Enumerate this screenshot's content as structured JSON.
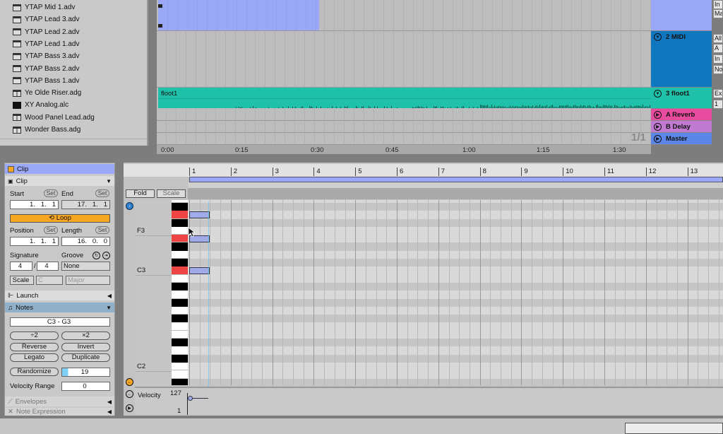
{
  "browser": {
    "items": [
      {
        "label": "YTAP Mid 1.adv",
        "icon": "preset-icon"
      },
      {
        "label": "YTAP Lead 3.adv",
        "icon": "preset-icon"
      },
      {
        "label": "YTAP Lead 2.adv",
        "icon": "preset-icon"
      },
      {
        "label": "YTAP Lead 1.adv",
        "icon": "preset-icon"
      },
      {
        "label": "YTAP Bass 3.adv",
        "icon": "preset-icon"
      },
      {
        "label": "YTAP Bass 2.adv",
        "icon": "preset-icon"
      },
      {
        "label": "YTAP Bass 1.adv",
        "icon": "preset-icon"
      },
      {
        "label": "Ye Olde Riser.adg",
        "icon": "rack-icon"
      },
      {
        "label": "XY Analog.alc",
        "icon": "live-clip-icon"
      },
      {
        "label": "Wood Panel Lead.adg",
        "icon": "rack-icon"
      },
      {
        "label": "Wonder Bass.adg",
        "icon": "rack-icon"
      }
    ]
  },
  "arrangement": {
    "clip_name": "floot1",
    "time_ruler": [
      "0:00",
      "0:15",
      "0:30",
      "0:45",
      "1:00",
      "1:15",
      "1:30"
    ],
    "pager": "1/1",
    "tracks": [
      {
        "name": "2 MIDI",
        "color": "#0f77c0"
      },
      {
        "name": "3  floot1",
        "color": "#1fc1aa"
      },
      {
        "name": "A Reverb",
        "color": "#e84a9d"
      },
      {
        "name": "B Delay",
        "color": "#c07ad0"
      },
      {
        "name": "Master",
        "color": "#5b85e6"
      }
    ],
    "track1_color": "#9ba8f7",
    "io_fragments": [
      "In",
      "Ma",
      "All",
      "A",
      "In",
      "No",
      "Ex",
      "1"
    ]
  },
  "clip_panel": {
    "title": "Clip",
    "section": "Clip",
    "start_label": "Start",
    "end_label": "End",
    "set": "Set",
    "start": "1.   1.   1",
    "end": "17.   1.   1",
    "loop": "Loop",
    "position_label": "Position",
    "length_label": "Length",
    "position": "1.   1.   1",
    "length": "16.   0.   0",
    "signature_label": "Signature",
    "groove_label": "Groove",
    "sig_num": "4",
    "sig_den": "4",
    "groove": "None",
    "scale_btn": "Scale",
    "scale_root": "C",
    "scale_mode": "Major",
    "launch": "Launch",
    "notes": "Notes",
    "note_range": "C3 - G3",
    "halve": "÷2",
    "double": "×2",
    "reverse": "Reverse",
    "invert": "Invert",
    "legato": "Legato",
    "duplicate": "Duplicate",
    "randomize": "Randomize",
    "randomize_value": "19",
    "velocity_range_label": "Velocity Range",
    "velocity_range": "0",
    "envelopes": "Envelopes",
    "note_expression": "Note Expression"
  },
  "piano_roll": {
    "bars": [
      "1",
      "2",
      "3",
      "4",
      "5",
      "6",
      "7",
      "8",
      "9",
      "10",
      "11",
      "12",
      "13"
    ],
    "fold": "Fold",
    "scale": "Scale",
    "note_labels": [
      "F3",
      "C3",
      "C2"
    ],
    "notes": [
      {
        "pitch": "G3",
        "start_bar": 1,
        "beats": 2
      },
      {
        "pitch": "E3",
        "start_bar": 1,
        "beats": 2
      },
      {
        "pitch": "C3",
        "start_bar": 1,
        "beats": 2
      }
    ],
    "velocity_label": "Velocity",
    "vel_max": "127",
    "vel_min": "1",
    "highlight_color": "#ef4444",
    "note_color": "#a0abe8"
  }
}
